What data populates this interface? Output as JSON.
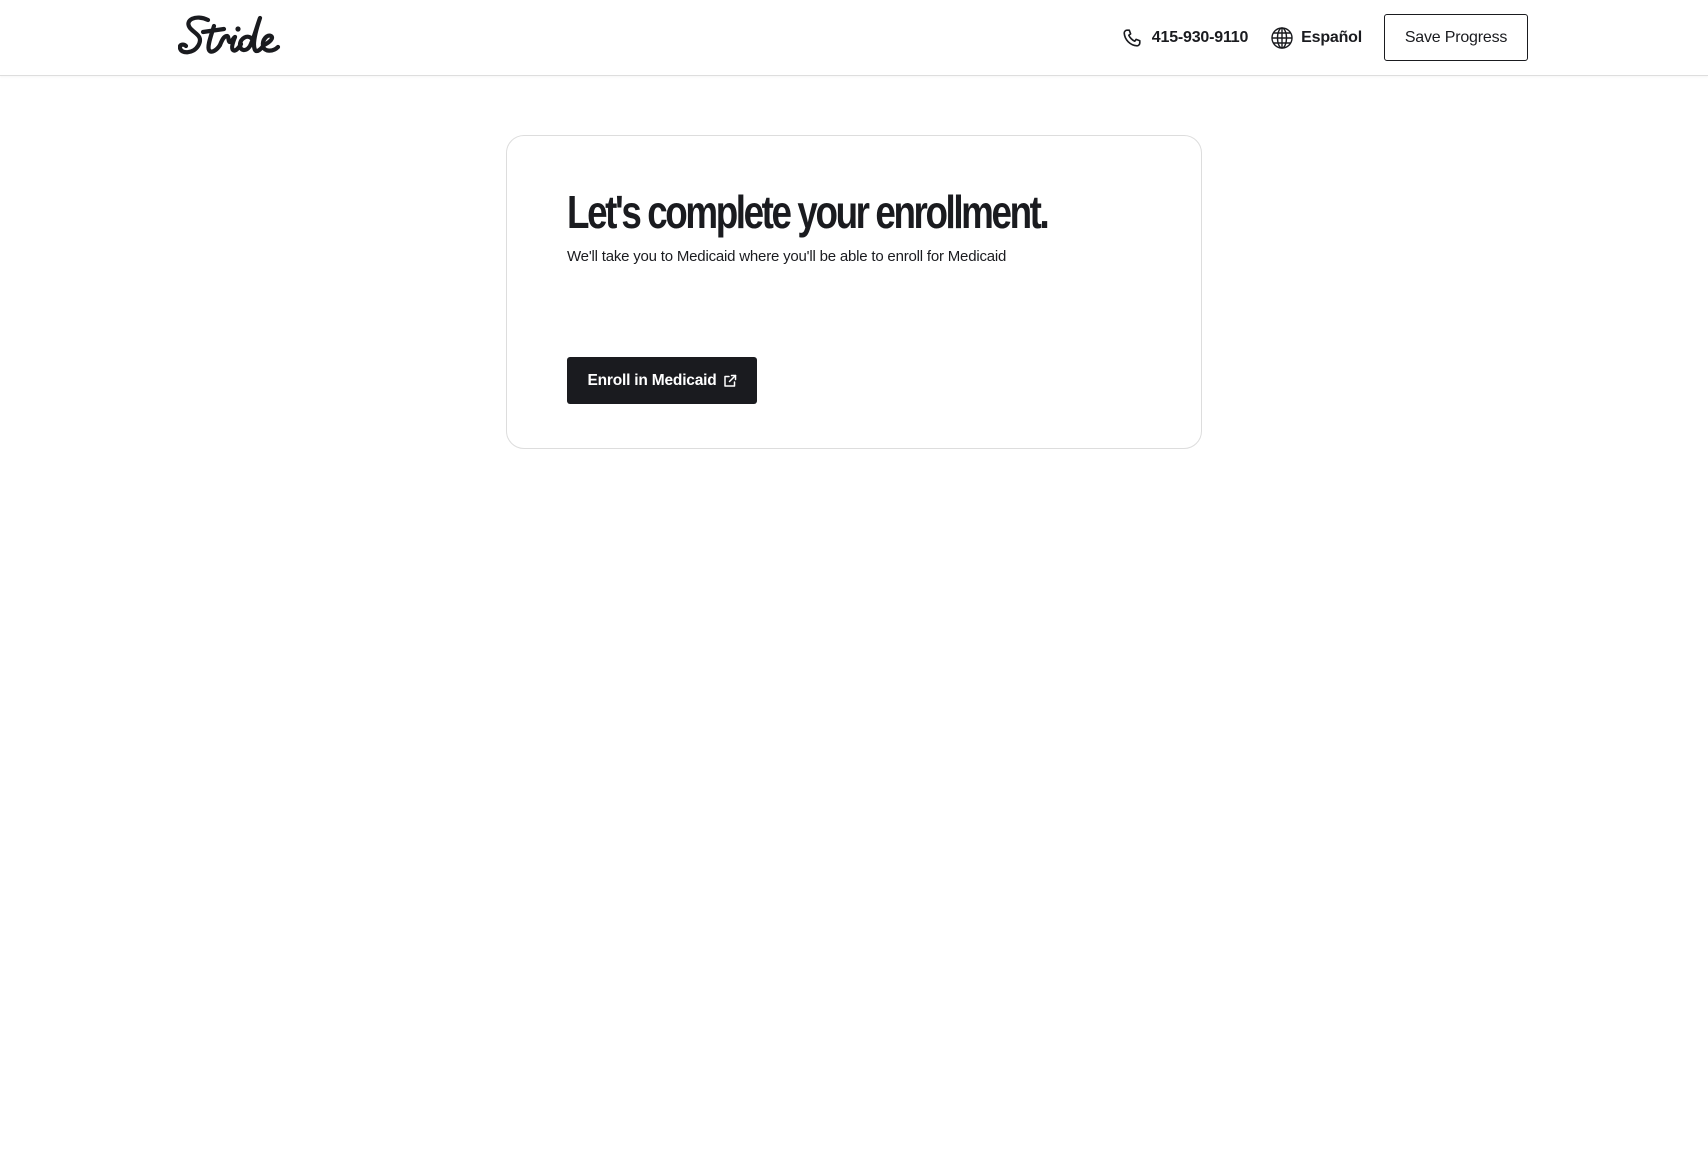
{
  "header": {
    "brand": "Stride",
    "phone": "415-930-9110",
    "language_label": "Español",
    "save_label": "Save Progress",
    "icons": {
      "logo": "stride-logo",
      "phone": "phone-icon",
      "language": "globe-icon"
    }
  },
  "card": {
    "title": "Let's complete your enrollment.",
    "subtitle": "We'll take you to Medicaid where you'll be able to enroll for Medicaid",
    "button_label": "Enroll in Medicaid",
    "button_icon": "external-link-icon"
  },
  "colors": {
    "text": "#1a1b1f",
    "button_bg": "#1a1b1f",
    "border": "#dddddd",
    "background": "#ffffff"
  }
}
